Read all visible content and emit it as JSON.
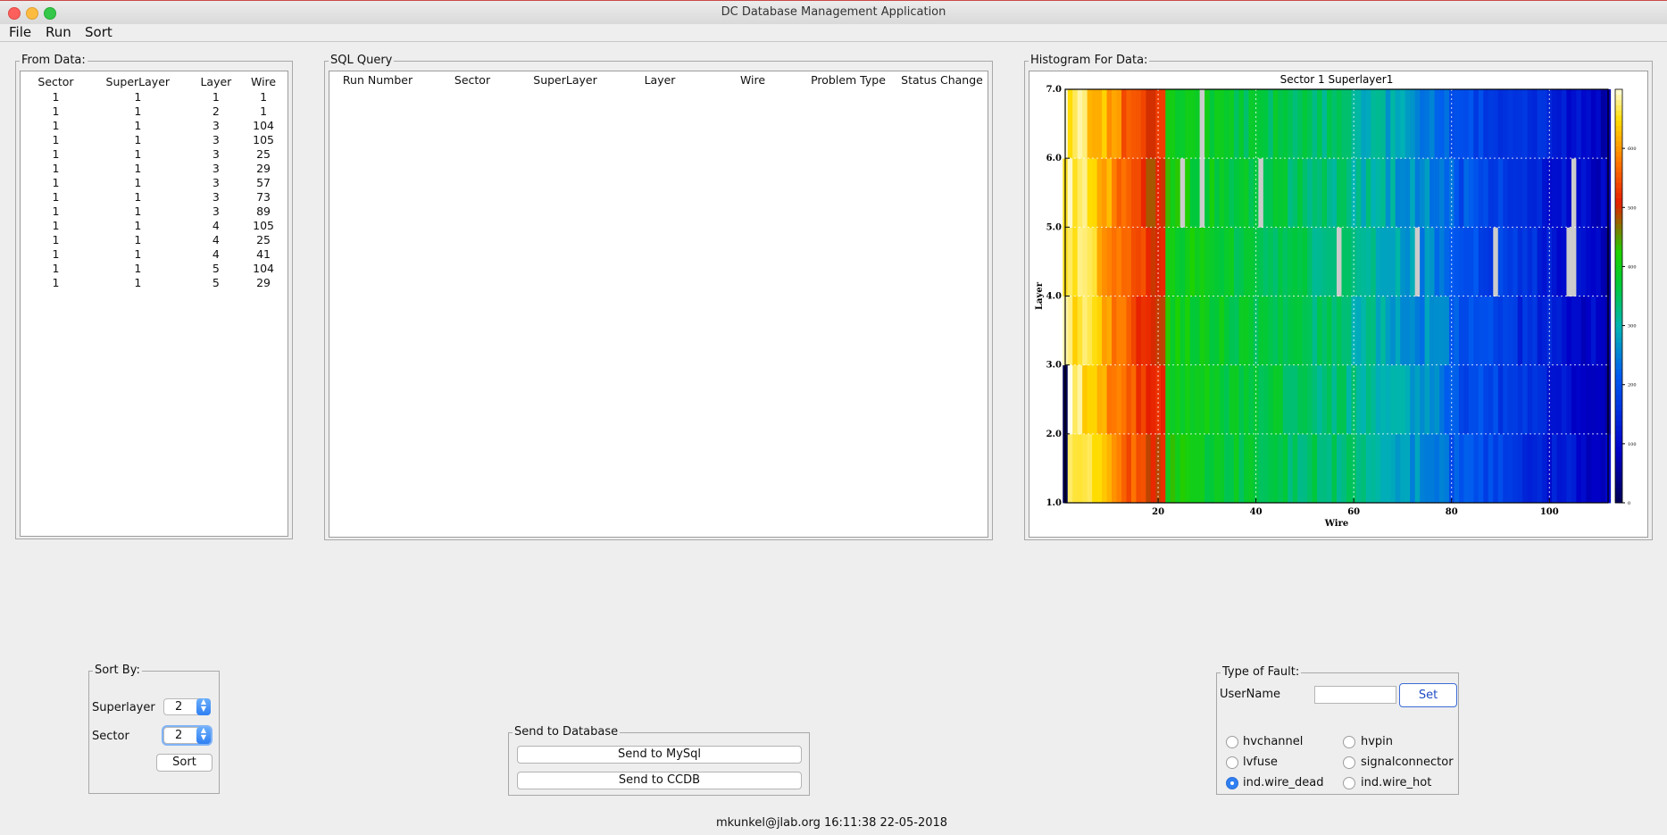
{
  "window": {
    "title": "DC Database Management Application"
  },
  "menu": [
    "File",
    "Run",
    "Sort"
  ],
  "from_data": {
    "title": "From Data:",
    "columns": [
      "Sector",
      "SuperLayer",
      "Layer",
      "Wire"
    ],
    "rows": [
      [
        "1",
        "1",
        "1",
        "1"
      ],
      [
        "1",
        "1",
        "2",
        "1"
      ],
      [
        "1",
        "1",
        "3",
        "104"
      ],
      [
        "1",
        "1",
        "3",
        "105"
      ],
      [
        "1",
        "1",
        "3",
        "25"
      ],
      [
        "1",
        "1",
        "3",
        "29"
      ],
      [
        "1",
        "1",
        "3",
        "57"
      ],
      [
        "1",
        "1",
        "3",
        "73"
      ],
      [
        "1",
        "1",
        "3",
        "89"
      ],
      [
        "1",
        "1",
        "4",
        "105"
      ],
      [
        "1",
        "1",
        "4",
        "25"
      ],
      [
        "1",
        "1",
        "4",
        "41"
      ],
      [
        "1",
        "1",
        "5",
        "104"
      ],
      [
        "1",
        "1",
        "5",
        "29"
      ]
    ]
  },
  "sql_query": {
    "title": "SQL Query",
    "columns": [
      "Run Number",
      "Sector",
      "SuperLayer",
      "Layer",
      "Wire",
      "Problem Type",
      "Status Change"
    ]
  },
  "histogram": {
    "panel_title": "Histogram For Data:",
    "chart_data": {
      "type": "heatmap",
      "title": "Sector 1 Superlayer1",
      "xlabel": "Wire",
      "ylabel": "Layer",
      "xlim": [
        1,
        112
      ],
      "ylim": [
        1.0,
        7.0
      ],
      "xticks": [
        "20",
        "40",
        "60",
        "80",
        "100"
      ],
      "yticks": [
        "1.0",
        "2.0",
        "3.0",
        "4.0",
        "5.0",
        "6.0",
        "7.0"
      ],
      "colorbar_ticks": [
        "0",
        "100",
        "200",
        "300",
        "400",
        "500",
        "600"
      ],
      "colorbar_max": 700,
      "grid": true,
      "dead_wires": [
        [
          29,
          5
        ],
        [
          29,
          6
        ],
        [
          57,
          4
        ],
        [
          73,
          4
        ],
        [
          89,
          4
        ],
        [
          104,
          4
        ],
        [
          105,
          4
        ],
        [
          105,
          5
        ],
        [
          41,
          5
        ],
        [
          25,
          5
        ]
      ]
    }
  },
  "sort_by": {
    "title": "Sort By:",
    "superlayer_label": "Superlayer",
    "superlayer_value": "2",
    "sector_label": "Sector",
    "sector_value": "2",
    "sort_button": "Sort"
  },
  "send_db": {
    "title": "Send to Database",
    "mysql_button": "Send to MySql",
    "ccdb_button": "Send to CCDB"
  },
  "fault": {
    "title": "Type of Fault:",
    "username_label": "UserName",
    "username_value": "",
    "set_button": "Set",
    "options": [
      {
        "label": "hvchannel",
        "checked": false
      },
      {
        "label": "hvpin",
        "checked": false
      },
      {
        "label": "lvfuse",
        "checked": false
      },
      {
        "label": "signalconnector",
        "checked": false
      },
      {
        "label": "ind.wire_dead",
        "checked": true
      },
      {
        "label": "ind.wire_hot",
        "checked": false
      }
    ]
  },
  "status": {
    "text": "mkunkel@jlab.org 16:11:38  22-05-2018"
  },
  "colors": {
    "accent": "#2f7ff2",
    "window_bg": "#eeeeee"
  }
}
